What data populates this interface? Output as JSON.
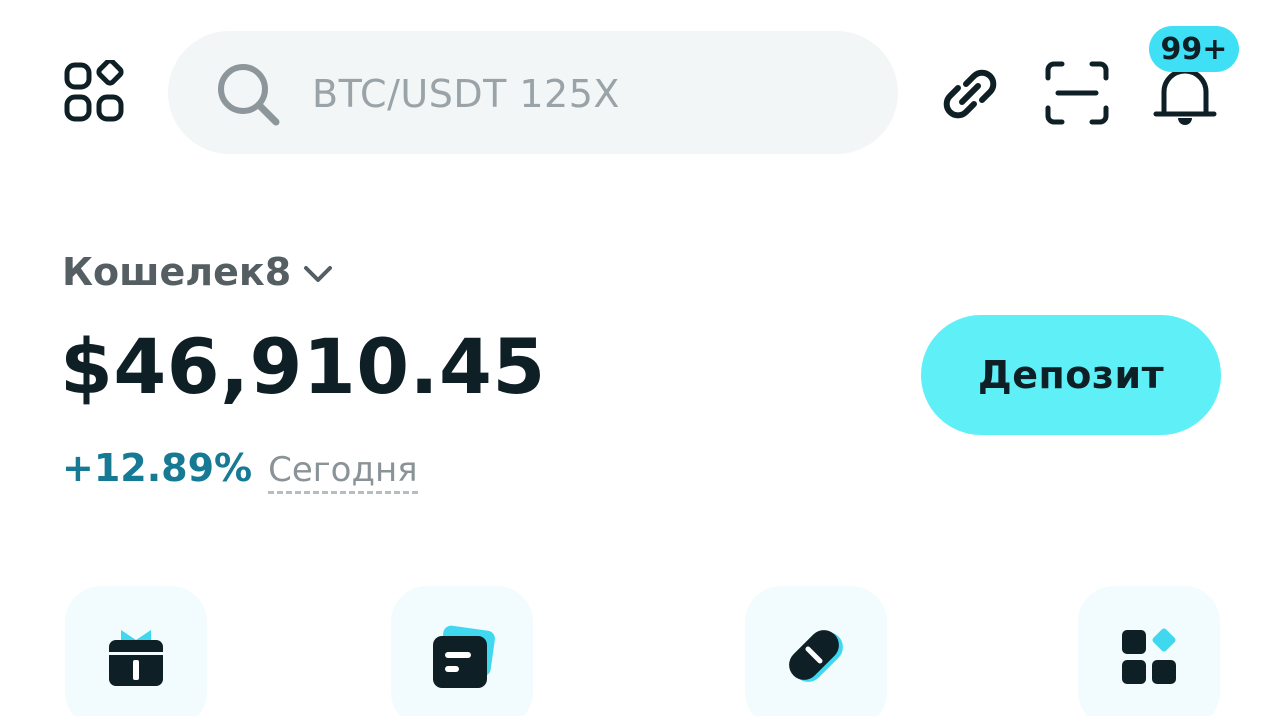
{
  "header": {
    "menu_icon": "apps-grid-icon",
    "search": {
      "placeholder": "BTC/USDT 125X",
      "icon": "search-icon"
    },
    "actions": [
      {
        "icon": "link-icon"
      },
      {
        "icon": "scan-icon"
      },
      {
        "icon": "bell-icon",
        "badge": "99+"
      }
    ]
  },
  "wallet": {
    "name": "Кошелек8",
    "balance": "$46,910.45",
    "change": "+12.89%",
    "period": "Сегодня",
    "deposit_label": "Депозит"
  },
  "quick_actions": [
    {
      "icon": "gift-icon"
    },
    {
      "icon": "card-icon"
    },
    {
      "icon": "pill-icon"
    },
    {
      "icon": "more-apps-icon"
    }
  ],
  "colors": {
    "accent": "#5eeff7",
    "badge": "#3fe0f5",
    "positive": "#167a95",
    "text_dark": "#0f1f26",
    "search_bg": "#f2f6f7",
    "tile_bg": "#f2fbfd"
  }
}
